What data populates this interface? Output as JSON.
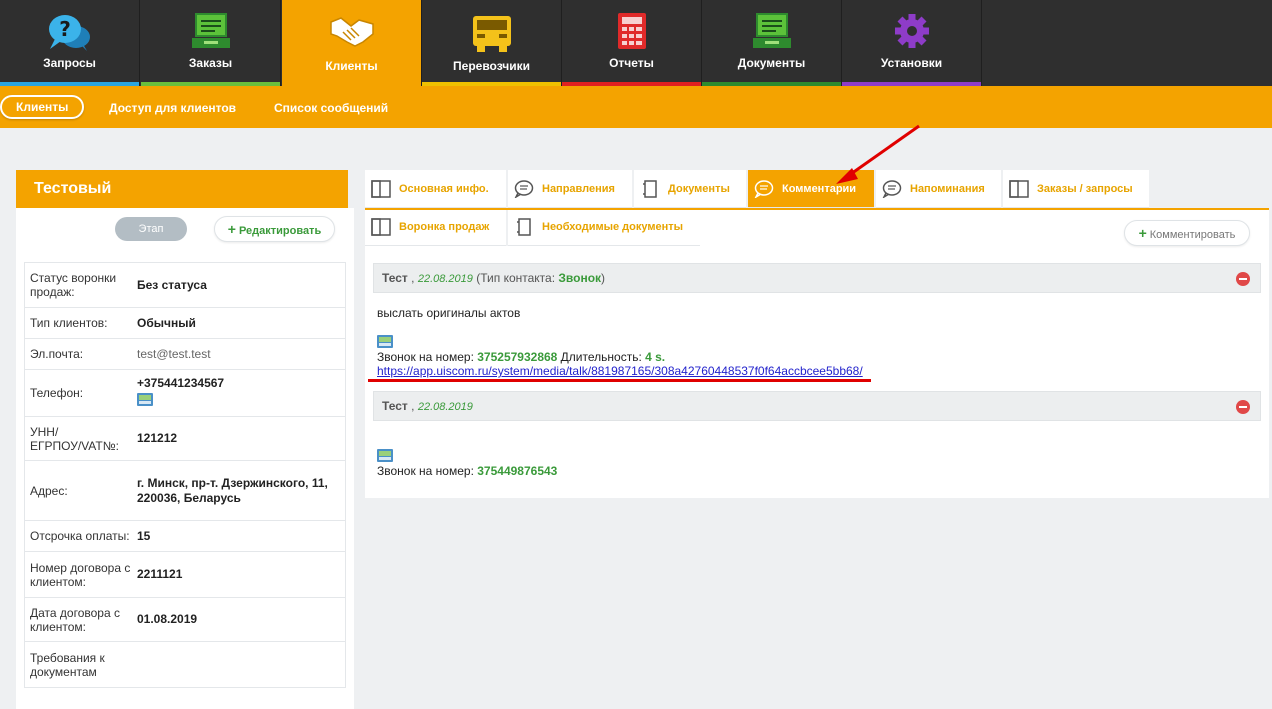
{
  "topnav": [
    {
      "label": "Запросы",
      "icon": "help-bubble-icon",
      "color": "#2aa5e0"
    },
    {
      "label": "Заказы",
      "icon": "orders-screen-icon",
      "color": "#6abf3c"
    },
    {
      "label": "Клиенты",
      "icon": "handshake-icon",
      "color": "#f4a300"
    },
    {
      "label": "Перевозчики",
      "icon": "truck-icon",
      "color": "#f0c000"
    },
    {
      "label": "Отчеты",
      "icon": "calculator-icon",
      "color": "#e02020"
    },
    {
      "label": "Документы",
      "icon": "documents-screen-icon",
      "color": "#2e8b2e"
    },
    {
      "label": "Установки",
      "icon": "gear-icon",
      "color": "#8e3cc8"
    }
  ],
  "subnav": {
    "clients": "Клиенты",
    "access": "Доступ для клиентов",
    "messages": "Список сообщений"
  },
  "client": {
    "name": "Тестовый",
    "stage_label": "Этап",
    "edit_label": "Редактировать",
    "fields": [
      {
        "label": "Статус воронки продаж:",
        "value": "Без статуса"
      },
      {
        "label": "Тип клиентов:",
        "value": "Обычный"
      },
      {
        "label": "Эл.почта:",
        "value": "test@test.test"
      },
      {
        "label": "Телефон:",
        "value": "+375441234567"
      },
      {
        "label": "УНН/ЕГРПОУ/VAT№:",
        "value": "121212"
      },
      {
        "label": "Адрес:",
        "value": "г. Минск, пр-т. Дзержинского, 11, 220036, Беларусь"
      },
      {
        "label": "Отсрочка оплаты:",
        "value": "15"
      },
      {
        "label": "Номер договора с клиентом:",
        "value": "2211121"
      },
      {
        "label": "Дата договора с клиентом:",
        "value": "01.08.2019"
      },
      {
        "label": "Требования к документам",
        "value": ""
      }
    ]
  },
  "tabs": [
    {
      "label": "Основная инфо.",
      "icon": "panel-icon"
    },
    {
      "label": "Направления",
      "icon": "chat-icon"
    },
    {
      "label": "Документы",
      "icon": "document-icon"
    },
    {
      "label": "Комментарии",
      "icon": "chat-icon",
      "active": true
    },
    {
      "label": "Напоминания",
      "icon": "chat-icon"
    },
    {
      "label": "Заказы / запросы",
      "icon": "panel-icon"
    },
    {
      "label": "Воронка продаж",
      "icon": "panel-icon"
    },
    {
      "label": "Необходимые документы",
      "icon": "document-icon"
    }
  ],
  "comment_button": "Комментировать",
  "comments": [
    {
      "author": "Тест",
      "sep": " , ",
      "date": "22.08.2019",
      "type_prefix": "(Тип контакта: ",
      "type": "Звонок",
      "type_suffix": ")",
      "text": "выслать оригиналы актов",
      "call_prefix": "Звонок на номер: ",
      "call_number": "375257932868",
      "duration_prefix": " Длительность: ",
      "duration": "4 s.",
      "link": "https://app.uiscom.ru/system/media/talk/881987165/308a42760448537f0f64accbcee5bb68/"
    },
    {
      "author": "Тест",
      "sep": " , ",
      "date": "22.08.2019",
      "call_prefix": "Звонок на номер: ",
      "call_number": "375449876543"
    }
  ],
  "colors": {
    "accent": "#f4a300",
    "nav_bg": "#2f2f2f",
    "green": "#3a9a3a",
    "link": "#2222cc",
    "annotation_red": "#e00000"
  }
}
